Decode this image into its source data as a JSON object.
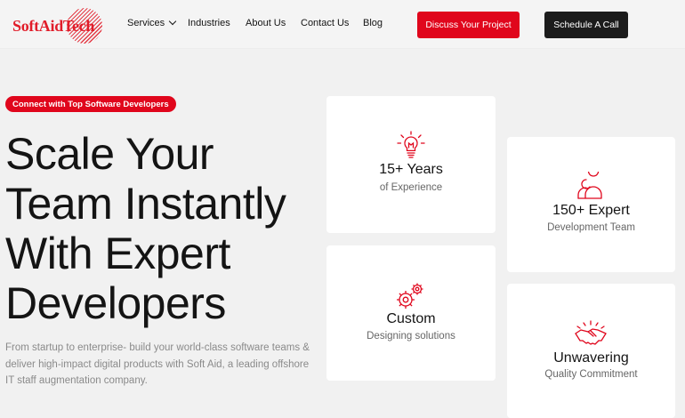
{
  "brand": {
    "name": "SoftAidTech",
    "color": "#e0061c"
  },
  "nav": {
    "items": [
      {
        "label": "Services",
        "has_dropdown": true
      },
      {
        "label": "Industries"
      },
      {
        "label": "About Us"
      },
      {
        "label": "Contact Us"
      },
      {
        "label": "Blog"
      }
    ],
    "primary_cta": "Discuss Your Project",
    "secondary_cta": "Schedule A Call"
  },
  "hero": {
    "badge": "Connect with Top Software Developers",
    "title_lines": [
      "Scale Your",
      "Team Instantly",
      "With Expert",
      "Developers"
    ],
    "description": "From startup to enterprise- build your world-class software teams & deliver high-impact digital products with Soft Aid, a leading offshore IT staff augmentation company."
  },
  "cards": [
    {
      "icon": "lightbulb-icon",
      "title": "15+ Years",
      "subtitle": "of Experience"
    },
    {
      "icon": "team-icon",
      "title": "150+ Expert",
      "subtitle": "Development Team"
    },
    {
      "icon": "gears-icon",
      "title": "Custom",
      "subtitle": "Designing solutions"
    },
    {
      "icon": "handshake-icon",
      "title": "Unwavering",
      "subtitle": "Quality Commitment"
    }
  ]
}
